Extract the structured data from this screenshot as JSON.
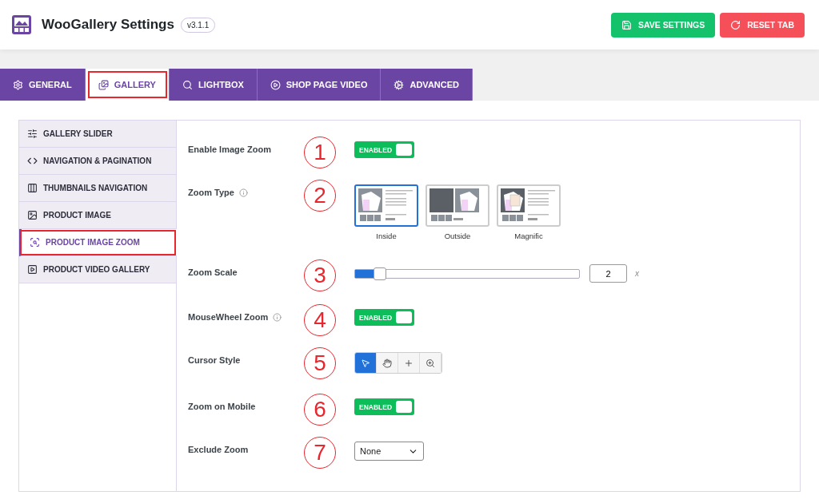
{
  "header": {
    "title": "WooGallery Settings",
    "version": "v3.1.1",
    "buttons": [
      {
        "kind": "save",
        "label": "SAVE SETTINGS"
      },
      {
        "kind": "reset",
        "label": "RESET TAB"
      }
    ]
  },
  "tabs": [
    {
      "kind": "general",
      "label": "GENERAL",
      "selected": false,
      "highlighted": false
    },
    {
      "kind": "gallery",
      "label": "GALLERY",
      "selected": true,
      "highlighted": true
    },
    {
      "kind": "lightbox",
      "label": "LIGHTBOX",
      "selected": false,
      "highlighted": false
    },
    {
      "kind": "video",
      "label": "SHOP PAGE VIDEO",
      "selected": false,
      "highlighted": false
    },
    {
      "kind": "advanced",
      "label": "ADVANCED",
      "selected": false,
      "highlighted": false
    }
  ],
  "sidebar": {
    "items": [
      {
        "kind": "slider",
        "label": "GALLERY SLIDER",
        "selected": false,
        "highlighted": false
      },
      {
        "kind": "nav",
        "label": "NAVIGATION & PAGINATION",
        "selected": false,
        "highlighted": false
      },
      {
        "kind": "thumbs",
        "label": "THUMBNAILS NAVIGATION",
        "selected": false,
        "highlighted": false
      },
      {
        "kind": "image",
        "label": "PRODUCT IMAGE",
        "selected": false,
        "highlighted": false
      },
      {
        "kind": "zoom",
        "label": "PRODUCT IMAGE ZOOM",
        "selected": true,
        "highlighted": true
      },
      {
        "kind": "video",
        "label": "PRODUCT VIDEO GALLERY",
        "selected": false,
        "highlighted": false
      }
    ]
  },
  "settings": [
    {
      "kind": "toggle",
      "label": "Enable Image Zoom",
      "info": false,
      "marker": "1",
      "on": true,
      "text": "ENABLED"
    },
    {
      "kind": "zoom_type",
      "label": "Zoom Type",
      "info": true,
      "marker": "2",
      "options": [
        {
          "label": "Inside",
          "selected": true
        },
        {
          "label": "Outside",
          "selected": false
        },
        {
          "label": "Magnific",
          "selected": false
        }
      ]
    },
    {
      "kind": "slider",
      "label": "Zoom Scale",
      "info": false,
      "marker": "3",
      "level": 0.11,
      "value": "2",
      "unit": "x"
    },
    {
      "kind": "toggle",
      "label": "MouseWheel Zoom",
      "info": true,
      "marker": "4",
      "on": true,
      "text": "ENABLED"
    },
    {
      "kind": "cursor",
      "label": "Cursor Style",
      "info": false,
      "marker": "5",
      "options": [
        {
          "kind": "pointer",
          "selected": true
        },
        {
          "kind": "hand",
          "selected": false
        },
        {
          "kind": "crosshair",
          "selected": false
        },
        {
          "kind": "zoom",
          "selected": false
        }
      ]
    },
    {
      "kind": "toggle",
      "label": "Zoom on Mobile",
      "info": false,
      "marker": "6",
      "on": true,
      "text": "ENABLED"
    },
    {
      "kind": "select",
      "label": "Exclude Zoom",
      "info": false,
      "marker": "7",
      "value": "None"
    }
  ]
}
